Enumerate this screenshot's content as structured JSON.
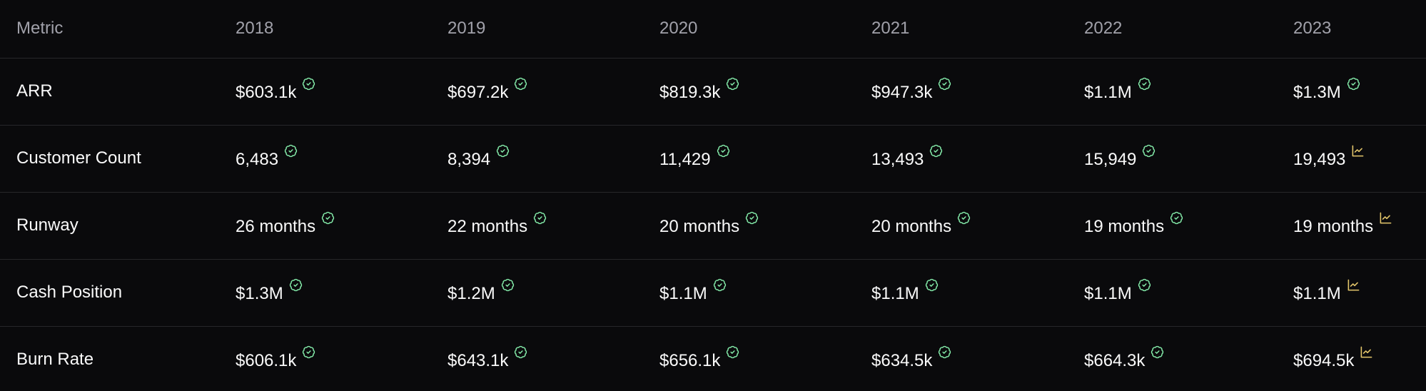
{
  "table": {
    "columns": [
      "Metric",
      "2018",
      "2019",
      "2020",
      "2021",
      "2022",
      "2023"
    ],
    "rows": [
      {
        "metric": "ARR",
        "cells": [
          {
            "value": "$603.1k",
            "icon": "verified-check-icon"
          },
          {
            "value": "$697.2k",
            "icon": "verified-check-icon"
          },
          {
            "value": "$819.3k",
            "icon": "verified-check-icon"
          },
          {
            "value": "$947.3k",
            "icon": "verified-check-icon"
          },
          {
            "value": "$1.1M",
            "icon": "verified-check-icon"
          },
          {
            "value": "$1.3M",
            "icon": "verified-check-icon"
          }
        ]
      },
      {
        "metric": "Customer Count",
        "cells": [
          {
            "value": "6,483",
            "icon": "verified-check-icon"
          },
          {
            "value": "8,394",
            "icon": "verified-check-icon"
          },
          {
            "value": "11,429",
            "icon": "verified-check-icon"
          },
          {
            "value": "13,493",
            "icon": "verified-check-icon"
          },
          {
            "value": "15,949",
            "icon": "verified-check-icon"
          },
          {
            "value": "19,493",
            "icon": "line-chart-icon"
          }
        ]
      },
      {
        "metric": "Runway",
        "cells": [
          {
            "value": "26 months",
            "icon": "verified-check-icon"
          },
          {
            "value": "22 months",
            "icon": "verified-check-icon"
          },
          {
            "value": "20 months",
            "icon": "verified-check-icon"
          },
          {
            "value": "20 months",
            "icon": "verified-check-icon"
          },
          {
            "value": "19 months",
            "icon": "verified-check-icon"
          },
          {
            "value": "19 months",
            "icon": "line-chart-icon"
          }
        ]
      },
      {
        "metric": "Cash Position",
        "cells": [
          {
            "value": "$1.3M",
            "icon": "verified-check-icon"
          },
          {
            "value": "$1.2M",
            "icon": "verified-check-icon"
          },
          {
            "value": "$1.1M",
            "icon": "verified-check-icon"
          },
          {
            "value": "$1.1M",
            "icon": "verified-check-icon"
          },
          {
            "value": "$1.1M",
            "icon": "verified-check-icon"
          },
          {
            "value": "$1.1M",
            "icon": "line-chart-icon"
          }
        ]
      },
      {
        "metric": "Burn Rate",
        "cells": [
          {
            "value": "$606.1k",
            "icon": "verified-check-icon"
          },
          {
            "value": "$643.1k",
            "icon": "verified-check-icon"
          },
          {
            "value": "$656.1k",
            "icon": "verified-check-icon"
          },
          {
            "value": "$634.5k",
            "icon": "verified-check-icon"
          },
          {
            "value": "$664.3k",
            "icon": "verified-check-icon"
          },
          {
            "value": "$694.5k",
            "icon": "line-chart-icon"
          }
        ]
      }
    ]
  },
  "colors": {
    "background": "#0a0a0c",
    "header_text": "#a1a1aa",
    "cell_text": "#fafafa",
    "divider": "#27272a",
    "verified": "#86efac",
    "projected": "#e5c76b"
  }
}
